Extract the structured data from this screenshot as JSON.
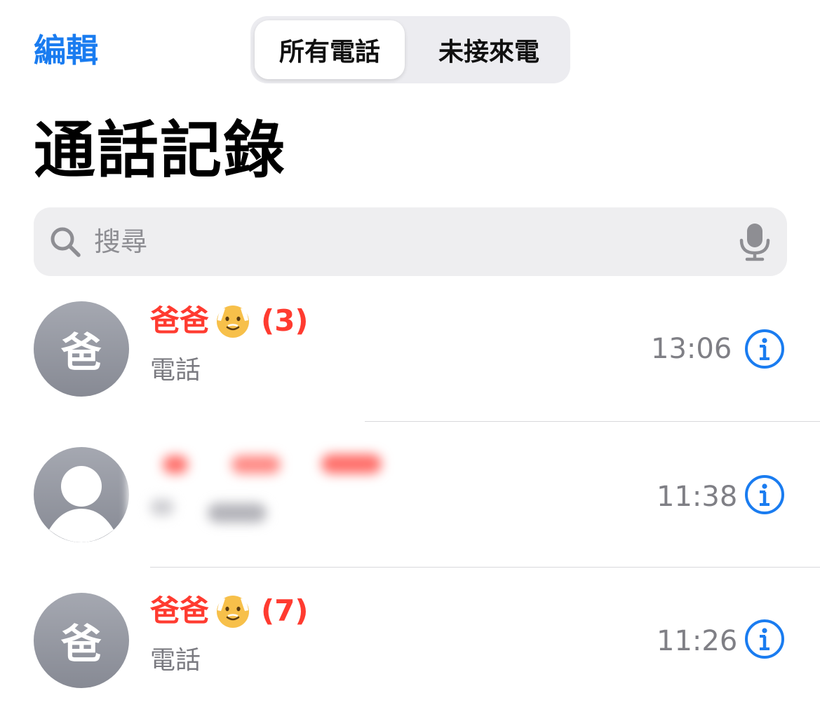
{
  "header": {
    "edit_label": "編輯",
    "segments": [
      {
        "label": "所有電話",
        "selected": true
      },
      {
        "label": "未接來電",
        "selected": false
      }
    ]
  },
  "title": "通話記錄",
  "search": {
    "placeholder": "搜尋",
    "icon": "magnifying-glass",
    "mic_icon": "microphone"
  },
  "calls": [
    {
      "avatar_initial": "爸",
      "name": "爸爸",
      "emoji": "older-man",
      "count": "(3)",
      "type": "電話",
      "time": "13:06",
      "missed": true
    },
    {
      "avatar_initial": "",
      "avatar_icon": "person-silhouette",
      "name": "",
      "emoji": "",
      "count": "",
      "type": "",
      "time": "11:38",
      "missed": true,
      "redacted": true
    },
    {
      "avatar_initial": "爸",
      "name": "爸爸",
      "emoji": "older-man",
      "count": "(7)",
      "type": "電話",
      "time": "11:26",
      "missed": true
    }
  ],
  "colors": {
    "accent": "#1a7cf0",
    "missed": "#ff3b30",
    "secondary_text": "#7a7a80"
  }
}
